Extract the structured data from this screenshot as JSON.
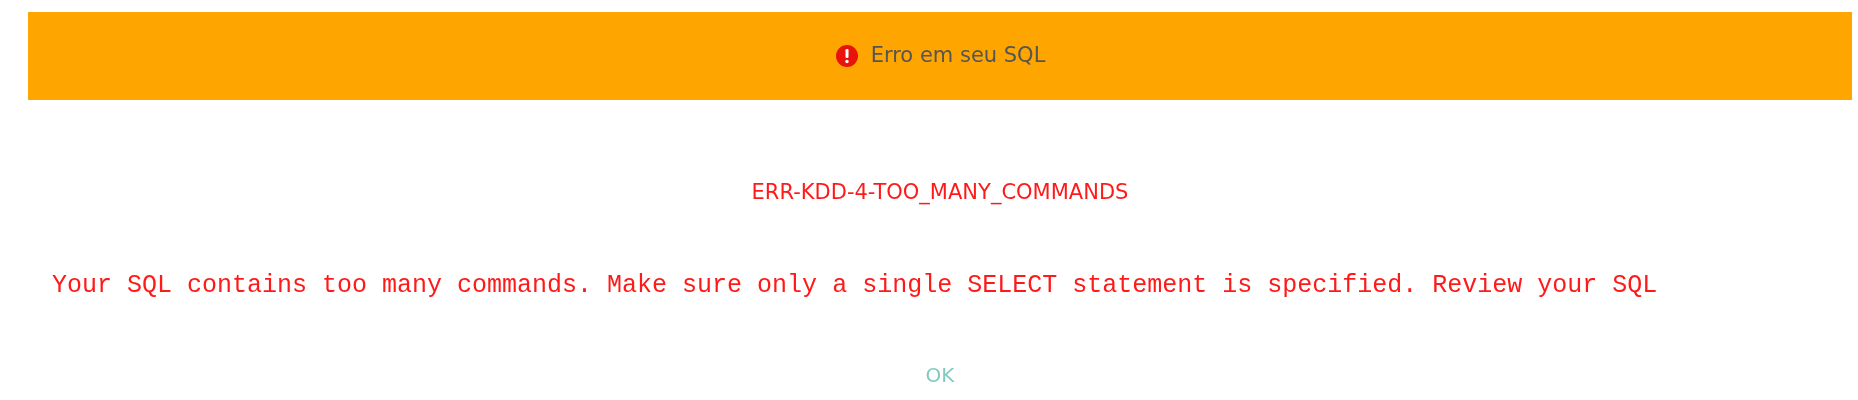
{
  "dialog": {
    "title": "Erro em seu SQL",
    "error_code": "ERR-KDD-4-TOO_MANY_COMMANDS",
    "message": "Your SQL contains too many commands. Make sure only a single SELECT statement is specified. Review your SQL",
    "buttons": [
      "OK"
    ]
  }
}
